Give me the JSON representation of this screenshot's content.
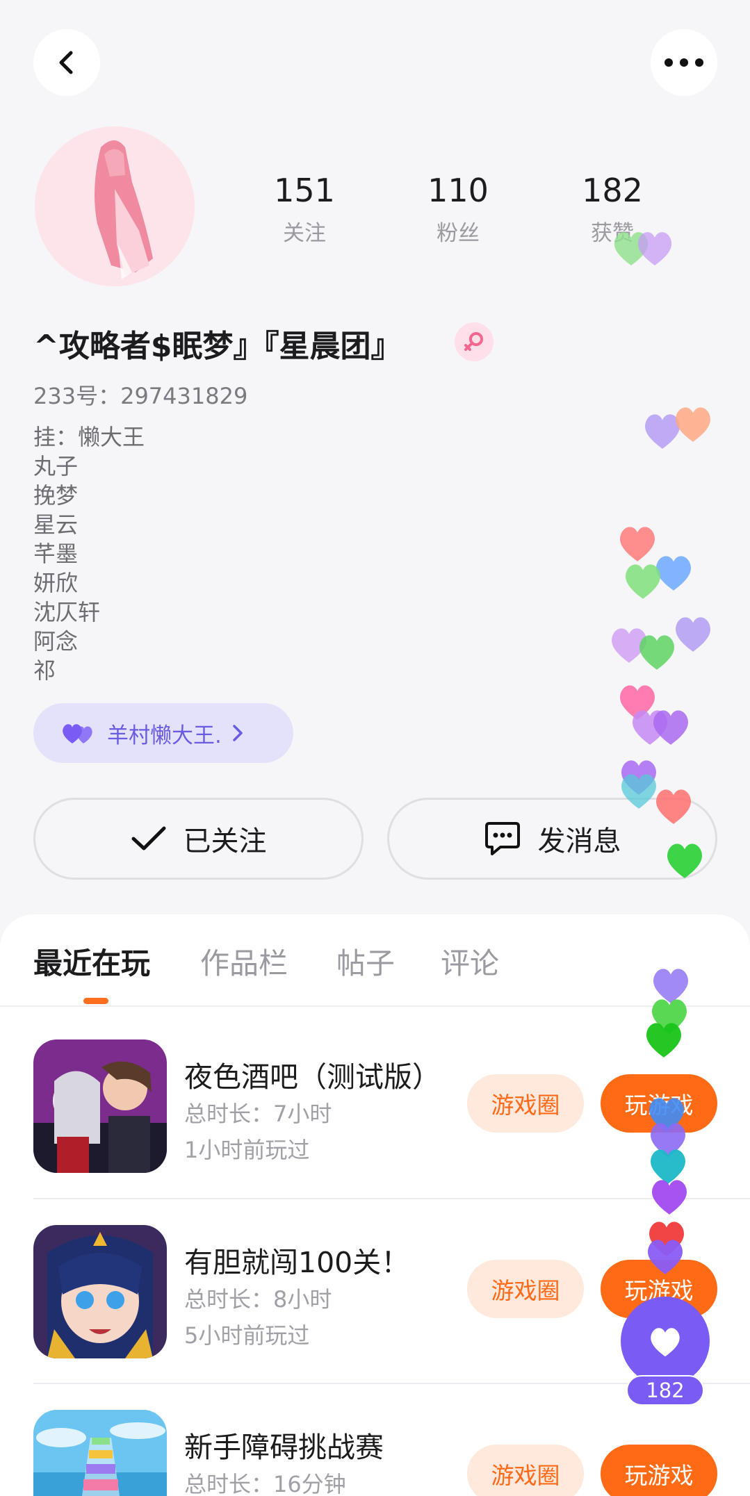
{
  "profile": {
    "stats": [
      {
        "value": "151",
        "label": "关注"
      },
      {
        "value": "110",
        "label": "粉丝"
      },
      {
        "value": "182",
        "label": "获赞"
      }
    ],
    "username": "^攻略者$眠梦』『星晨团』",
    "gender": "female",
    "uid": "233号：297431829",
    "bio_lines": [
      "挂：懒大王",
      "丸子",
      "挽梦",
      "星云",
      "芊墨",
      "妍欣",
      "沈仄轩",
      "阿念",
      "祁"
    ],
    "guild_label": "羊村懒大王.",
    "follow_label": "已关注",
    "message_label": "发消息"
  },
  "tabs": [
    {
      "label": "最近在玩",
      "active": true
    },
    {
      "label": "作品栏",
      "active": false
    },
    {
      "label": "帖子",
      "active": false
    },
    {
      "label": "评论",
      "active": false
    }
  ],
  "games": [
    {
      "title": "夜色酒吧（测试版）",
      "duration": "总时长：7小时",
      "last_played": "1小时前玩过",
      "circle_label": "游戏圈",
      "play_label": "玩游戏"
    },
    {
      "title": "有胆就闯100关！",
      "duration": "总时长：8小时",
      "last_played": "5小时前玩过",
      "circle_label": "游戏圈",
      "play_label": "玩游戏"
    },
    {
      "title": "新手障碍挑战赛",
      "duration": "总时长：16分钟",
      "last_played": "",
      "circle_label": "游戏圈",
      "play_label": "玩游戏"
    }
  ],
  "like_button": {
    "count": "182"
  },
  "colors": {
    "accent": "#ff6a14",
    "like": "#7a5cf5",
    "guild": "#6a5ce0"
  }
}
